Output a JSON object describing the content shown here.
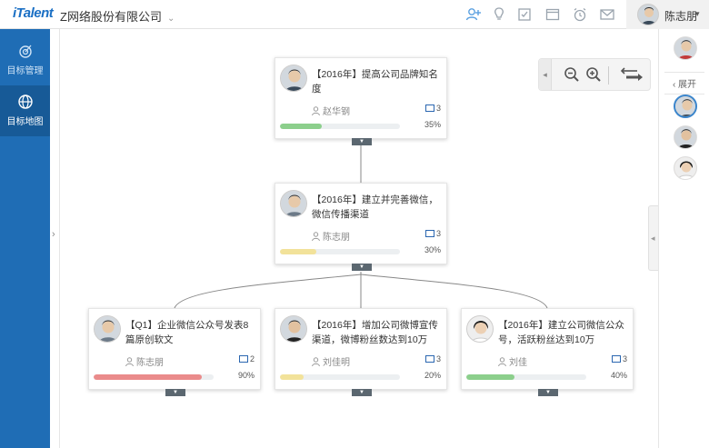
{
  "header": {
    "logo": "iTalent",
    "company": "Z网络股份有限公司",
    "company_caret": "⌄",
    "user_name": "陈志朋",
    "user_caret": "▾"
  },
  "sidebar": {
    "items": [
      {
        "label": "目标管理"
      },
      {
        "label": "目标地图"
      }
    ]
  },
  "right_panel": {
    "expand_label": "展开"
  },
  "cards": [
    {
      "title": "【2016年】提高公司品牌知名度",
      "owner": "赵华钢",
      "kr_count": "3",
      "progress_label": "35%",
      "progress": 0.35,
      "bar_color": "#8ccf8c"
    },
    {
      "title": "【2016年】建立并完善微信，微信传播渠道",
      "owner": "陈志朋",
      "kr_count": "3",
      "progress_label": "30%",
      "progress": 0.3,
      "bar_color": "#f2e29a"
    },
    {
      "title": "【Q1】企业微信公众号发表8篇原创软文",
      "owner": "陈志朋",
      "kr_count": "2",
      "progress_label": "90%",
      "progress": 0.9,
      "bar_color": "#ea8b8b"
    },
    {
      "title": "【2016年】增加公司微博宣传渠道，微博粉丝数达到10万",
      "owner": "刘佳明",
      "kr_count": "3",
      "progress_label": "20%",
      "progress": 0.2,
      "bar_color": "#f2e29a"
    },
    {
      "title": "【2016年】建立公司微信公众号，活跃粉丝达到10万",
      "owner": "刘佳",
      "kr_count": "3",
      "progress_label": "40%",
      "progress": 0.4,
      "bar_color": "#8ccf8c"
    }
  ],
  "colors": {
    "sidebar": "#1f6db5",
    "sidebar_active": "#175a97",
    "brand": "#1a6fc4"
  }
}
